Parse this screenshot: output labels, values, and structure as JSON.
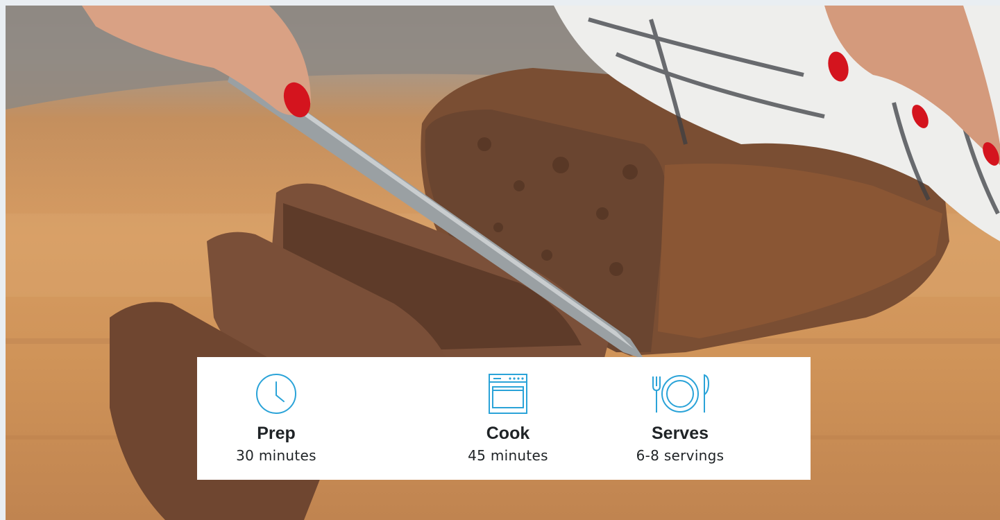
{
  "hero": {
    "image": "banana-bread-loaf-being-sliced-photo"
  },
  "recipe_info": {
    "prep": {
      "icon": "clock-icon",
      "label": "Prep",
      "value": "30 minutes"
    },
    "cook": {
      "icon": "oven-icon",
      "label": "Cook",
      "value": "45 minutes"
    },
    "serves": {
      "icon": "plate-cutlery-icon",
      "label": "Serves",
      "value": "6-8 servings"
    }
  },
  "colors": {
    "icon_accent": "#2aa3d8",
    "text": "#1f2326",
    "card_bg": "#ffffff",
    "page_bg": "#e9eef2"
  }
}
